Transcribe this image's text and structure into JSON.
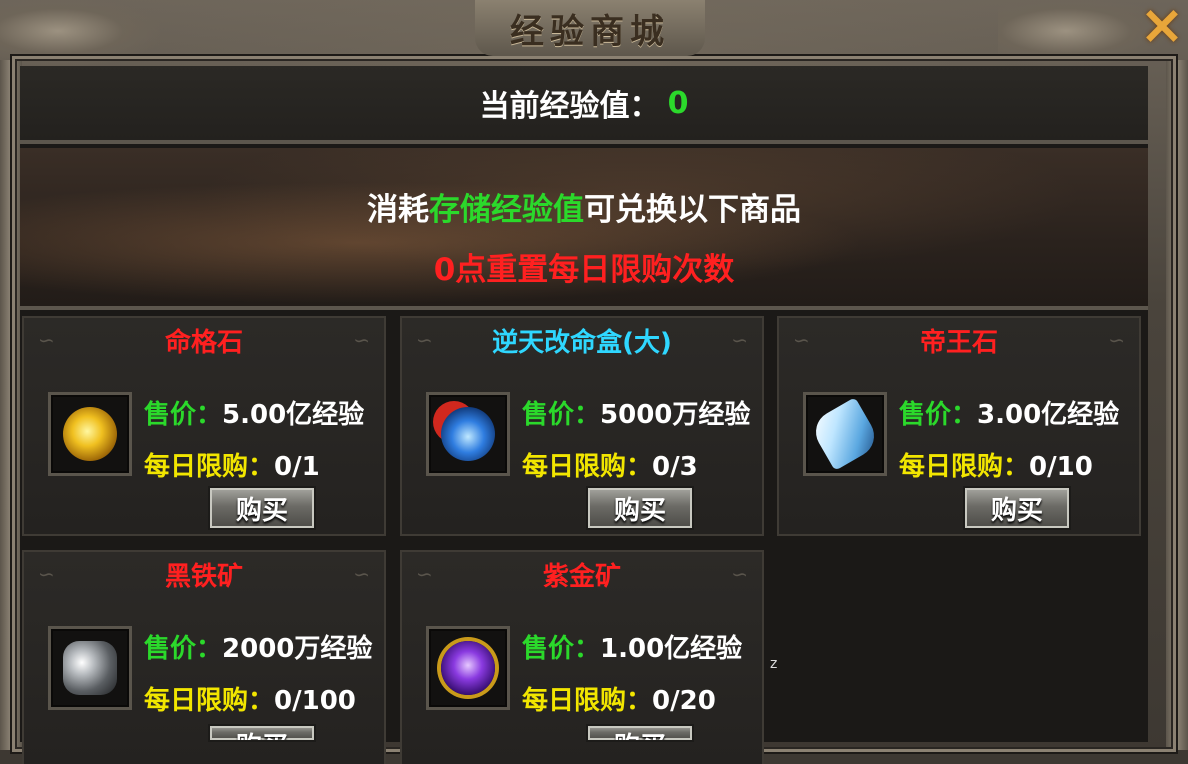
{
  "window": {
    "title": "经验商城",
    "close_label": "×"
  },
  "exp": {
    "label": "当前经验值：",
    "value": "0"
  },
  "banner": {
    "line1_prefix": "消耗",
    "line1_highlight": "存储经验值",
    "line1_suffix": "可兑换以下商品",
    "line2": "0点重置每日限购次数"
  },
  "colors": {
    "green": "#2bd92b",
    "yellow": "#f2e600",
    "red": "#ff2020",
    "cyan": "#2fd7ff"
  },
  "items": [
    {
      "name": "命格石",
      "name_color": "#ff2020",
      "icon": "golden-fate-stone-icon",
      "price_label": "售价：",
      "price": "5.00亿经验",
      "limit_label": "每日限购：",
      "limit": "0/1",
      "buy_label": "购买"
    },
    {
      "name": "逆天改命盒(大)",
      "name_color": "#2fd7ff",
      "icon": "fate-box-icon",
      "price_label": "售价：",
      "price": "5000万经验",
      "limit_label": "每日限购：",
      "limit": "0/3",
      "buy_label": "购买"
    },
    {
      "name": "帝王石",
      "name_color": "#ff2020",
      "icon": "crystal-emperor-stone-icon",
      "price_label": "售价：",
      "price": "3.00亿经验",
      "limit_label": "每日限购：",
      "limit": "0/10",
      "buy_label": "购买"
    },
    {
      "name": "黑铁矿",
      "name_color": "#ff2020",
      "icon": "black-iron-ore-icon",
      "price_label": "售价：",
      "price": "2000万经验",
      "limit_label": "每日限购：",
      "limit": "0/100",
      "buy_label": "购买"
    },
    {
      "name": "紫金矿",
      "name_color": "#ff2020",
      "icon": "purple-gold-ore-icon",
      "price_label": "售价：",
      "price": "1.00亿经验",
      "limit_label": "每日限购：",
      "limit": "0/20",
      "buy_label": "购买"
    }
  ],
  "stray_text": "z"
}
